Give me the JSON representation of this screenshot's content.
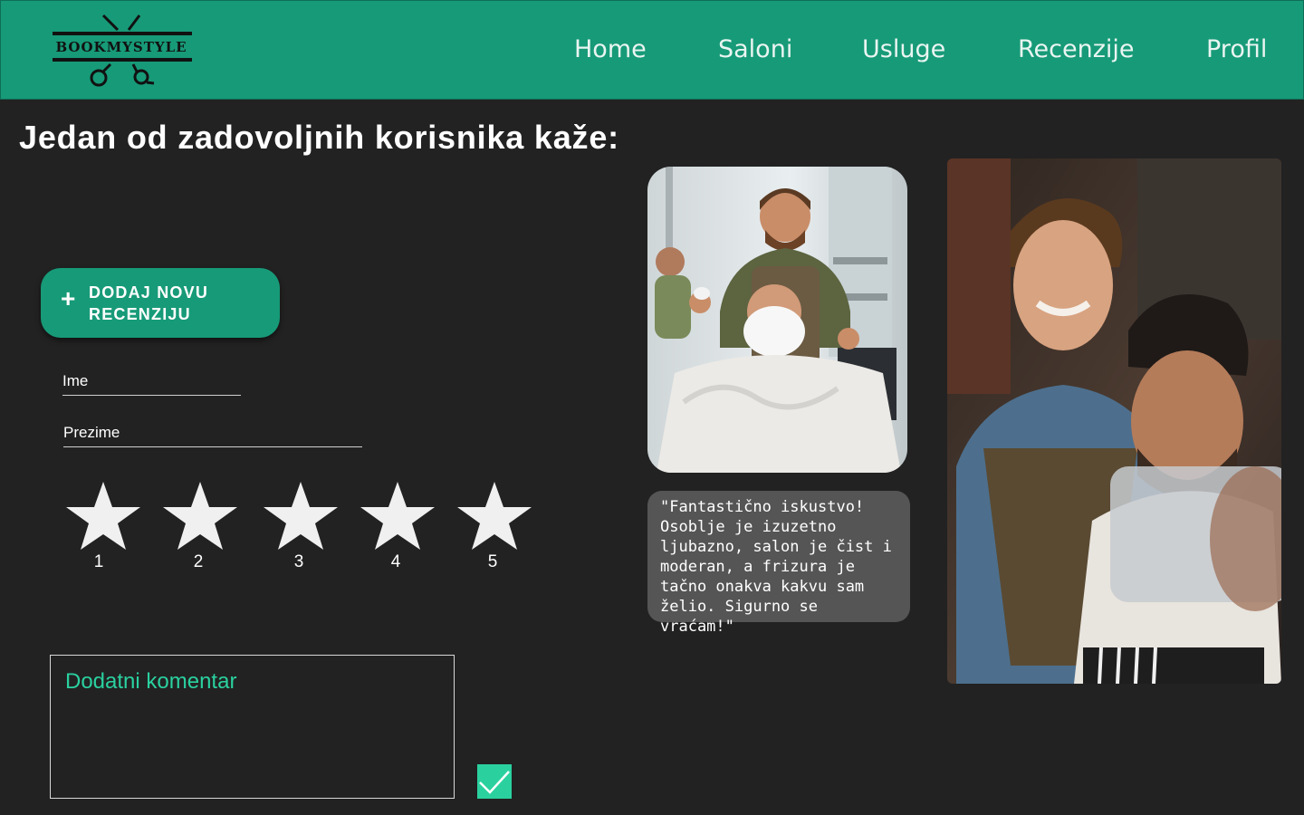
{
  "brand": {
    "name": "BOOKMYSTYLE"
  },
  "nav": {
    "items": [
      {
        "label": "Home"
      },
      {
        "label": "Saloni"
      },
      {
        "label": "Usluge"
      },
      {
        "label": "Recenzije"
      },
      {
        "label": "Profil"
      }
    ]
  },
  "main": {
    "title": "Jedan od zadovoljnih korisnika kaže:",
    "add_button": {
      "icon": "plus-icon",
      "label": "DODAJ NOVU RECENZIJU"
    },
    "form": {
      "first_name_placeholder": "Ime",
      "last_name_placeholder": "Prezime",
      "rating": {
        "stars": [
          "1",
          "2",
          "3",
          "4",
          "5"
        ],
        "selected": 0
      },
      "comment_placeholder": "Dodatni komentar",
      "submit_icon": "checkmark-icon"
    },
    "testimonial": {
      "quote": "\"Fantastično iskustvo! Osoblje je izuzetno ljubazno, salon je čist i moderan, a frizura je tačno onakva kakvu sam želio. Sigurno se vraćam!\""
    }
  },
  "colors": {
    "brand_green": "#179a78",
    "accent_teal": "#2ad19f",
    "background": "#222222",
    "quote_bg": "#555555",
    "star_fill": "#f0f0f0"
  }
}
